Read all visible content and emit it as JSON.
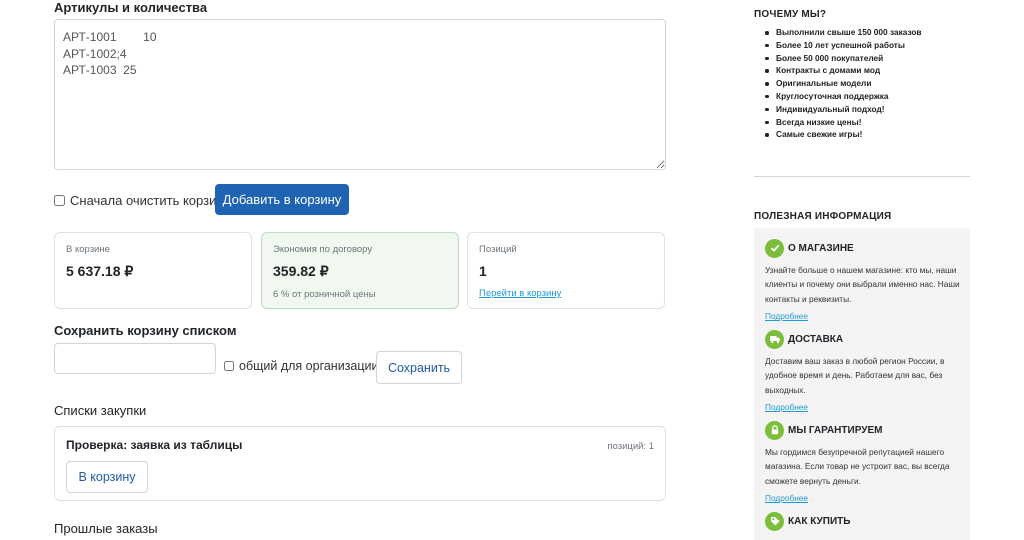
{
  "items_form": {
    "title": "Артикулы и количества",
    "textarea_value": "АРТ-1001        10\nАРТ-1002;4\nАРТ-1003  25",
    "clear_label": "Сначала очистить корзину",
    "add_button": "Добавить в корзину"
  },
  "summary": {
    "cart": {
      "label": "В корзине",
      "value": "5 637.18 ₽"
    },
    "savings": {
      "label": "Экономия по договору",
      "value": "359.82 ₽",
      "note": "6 % от розничной цены"
    },
    "positions": {
      "label": "Позиций",
      "value": "1",
      "link": "Перейти в корзину"
    }
  },
  "save_list": {
    "title": "Сохранить корзину списком",
    "input_value": "",
    "shared_label": "общий для организации",
    "save_button": "Сохранить"
  },
  "purchase_lists": {
    "title": "Списки закупки",
    "items": [
      {
        "name": "Проверка: заявка из таблицы",
        "count": "позиций: 1",
        "button": "В корзину"
      }
    ]
  },
  "past_orders": {
    "title": "Прошлые заказы"
  },
  "sidebar": {
    "why_title": "ПОЧЕМУ МЫ?",
    "why_items": [
      "Выполнили свыше 150 000 заказов",
      "Более 10 лет успешной работы",
      "Более 50 000 покупателей",
      "Контракты с домами мод",
      "Оригинальные модели",
      "Круглосуточная поддержка",
      "Индивидуальный подход!",
      "Всегда низкие цены!",
      "Самые свежие игры!"
    ],
    "info_title": "ПОЛЕЗНАЯ ИНФОРМАЦИЯ",
    "info_blocks": [
      {
        "icon": "check-icon",
        "title": "О МАГАЗИНЕ",
        "text": "Узнайте больше о нашем магазине: кто мы, наши клиенты и почему они выбрали именно нас. Наши контакты и реквизиты.",
        "link": "Подробнее"
      },
      {
        "icon": "truck-icon",
        "title": "ДОСТАВКА",
        "text": "Доставим ваш заказ в любой регион России, в удобное время и день. Работаем для вас, без выходных.",
        "link": "Подробнее"
      },
      {
        "icon": "lock-icon",
        "title": "МЫ ГАРАНТИРУЕМ",
        "text": "Мы гордимся безупречной репутацией нашего магазина. Если товар не устроит вас, вы всегда сможете вернуть деньги.",
        "link": "Подробнее"
      },
      {
        "icon": "tag-icon",
        "title": "КАК КУПИТЬ"
      }
    ],
    "accent_color": "#7bbe3c"
  },
  "colors": {
    "primary": "#1f63b3",
    "link": "#1f9ad6",
    "savings_bg": "#f0f8f0"
  }
}
